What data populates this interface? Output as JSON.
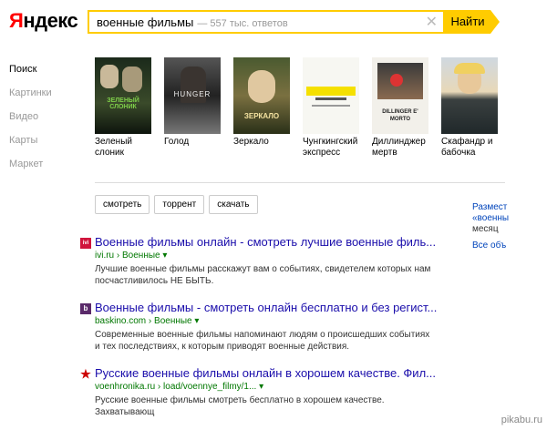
{
  "header": {
    "logo": "Яндекс",
    "query": "военные фильмы",
    "results_count": "— 557 тыс. ответов",
    "find_label": "Найти"
  },
  "nav": [
    {
      "label": "Поиск"
    },
    {
      "label": "Картинки"
    },
    {
      "label": "Видео"
    },
    {
      "label": "Карты"
    },
    {
      "label": "Маркет"
    }
  ],
  "movies": [
    {
      "title": "Зеленый слоник",
      "poster_label": "ЗЕЛЕНЫЙ СЛОНИК"
    },
    {
      "title": "Голод",
      "poster_label": "HUNGER"
    },
    {
      "title": "Зеркало",
      "poster_label": "ЗЕРКАЛО"
    },
    {
      "title": "Чунгкингский экспресс",
      "poster_label": ""
    },
    {
      "title": "Диллинджер мертв",
      "poster_label": "DILLINGER E' MORTO"
    },
    {
      "title": "Скафандр и бабочка",
      "poster_label": ""
    }
  ],
  "tags": [
    "смотреть",
    "торрент",
    "скачать"
  ],
  "right_panel": {
    "line1": "Размест",
    "line2": "«военны",
    "line3": "месяц",
    "line4": "Все объ"
  },
  "results": [
    {
      "favicon": "ivi",
      "title": "Военные фильмы онлайн - смотреть лучшие военные филь...",
      "url": "ivi.ru › Военные ▾",
      "desc": "Лучшие военные фильмы расскажут вам о событиях, свидетелем которых нам посчастливилось НЕ БЫТЬ."
    },
    {
      "favicon": "b",
      "title": "Военные фильмы - смотреть онлайн бесплатно и без регист...",
      "url": "baskino.com › Военные ▾",
      "desc": "Современные военные фильмы напоминают людям о происшедших событиях и тех последствиях, к которым приводят военные действия."
    },
    {
      "favicon": "★",
      "title": "Русские военные фильмы онлайн в хорошем качестве. Фил...",
      "url": "voenhronika.ru › load/voennye_filmy/1... ▾",
      "desc": "Русские военные фильмы смотреть бесплатно в хорошем качестве. Захватывающ"
    }
  ],
  "watermark": "pikabu.ru",
  "colors": {
    "accent": "#ffcc00",
    "link": "#1a0dab",
    "url": "#007700",
    "logo_red": "#ff0000"
  }
}
